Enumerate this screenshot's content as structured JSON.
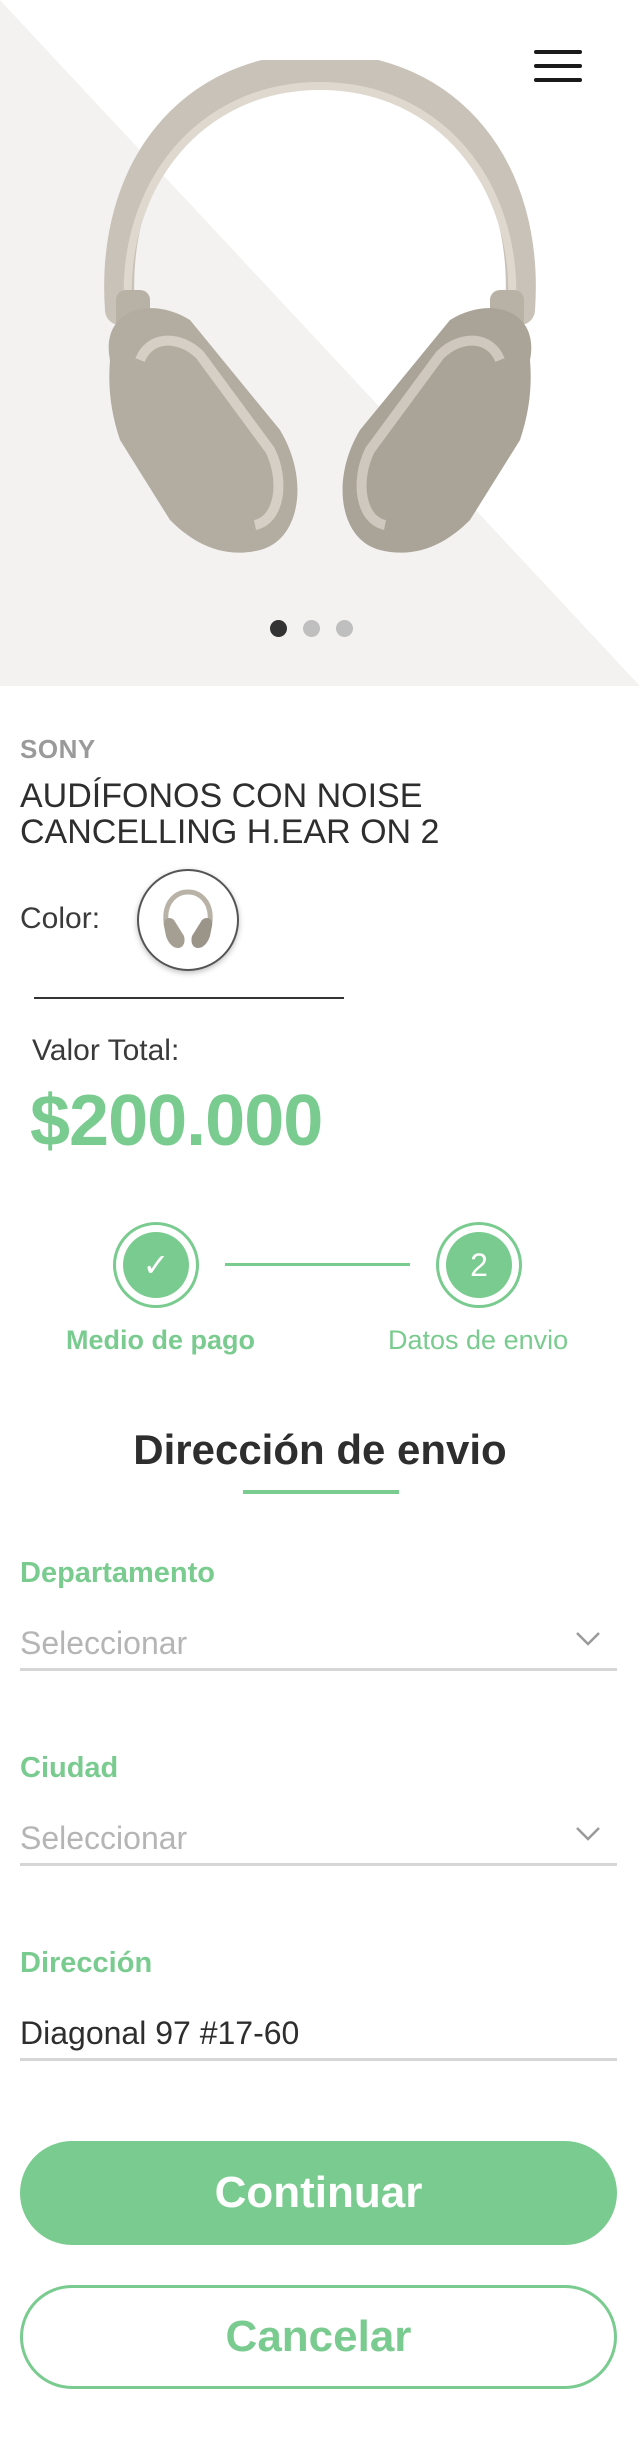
{
  "product": {
    "brand": "SONY",
    "title": "AUDÍFONOS CON NOISE CANCELLING H.EAR ON 2",
    "color_label": "Color:",
    "total_label": "Valor Total:",
    "total_value": "$200.000",
    "image_icon": "headphones",
    "carousel_pages": 3,
    "carousel_active": 1
  },
  "steps": [
    {
      "label": "Medio de pago",
      "icon": "check-icon",
      "marker": "✓"
    },
    {
      "label": "Datos de envio",
      "marker": "2"
    }
  ],
  "section": {
    "title": "Dirección de envio"
  },
  "form": {
    "departamento": {
      "label": "Departamento",
      "placeholder": "Seleccionar"
    },
    "ciudad": {
      "label": "Ciudad",
      "placeholder": "Seleccionar"
    },
    "direccion": {
      "label": "Dirección",
      "value": "Diagonal 97 #17-60"
    }
  },
  "buttons": {
    "primary": "Continuar",
    "secondary": "Cancelar"
  },
  "colors": {
    "accent": "#7acb8f",
    "text": "#2e2e2e",
    "muted": "#b5b5b5",
    "hero_bg": "#f3f2f1"
  }
}
